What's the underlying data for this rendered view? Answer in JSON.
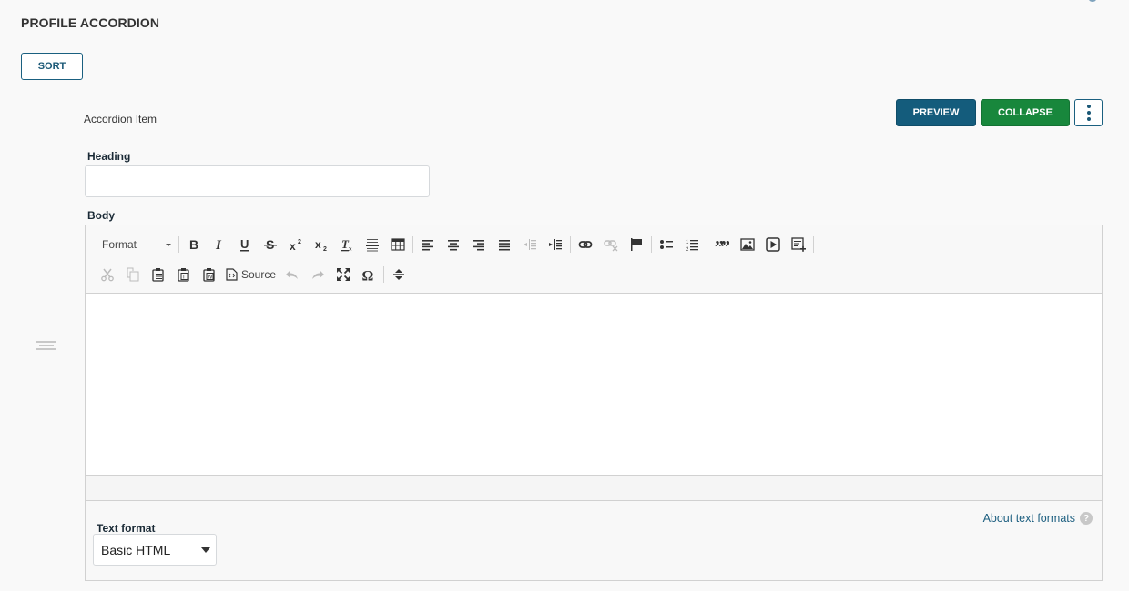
{
  "page": {
    "title": "PROFILE ACCORDION",
    "sort_label": "SORT"
  },
  "item": {
    "label": "Accordion Item",
    "preview_label": "PREVIEW",
    "collapse_label": "COLLAPSE",
    "more_icon": "vertical-ellipsis-icon"
  },
  "fields": {
    "heading": {
      "label": "Heading",
      "value": "",
      "placeholder": ""
    },
    "body": {
      "label": "Body",
      "value": ""
    }
  },
  "toolbar": {
    "format_label": "Format",
    "source_label": "Source",
    "row1": [
      "bold-icon",
      "italic-icon",
      "underline-icon",
      "strikethrough-icon",
      "superscript-icon",
      "subscript-icon",
      "remove-format-icon",
      "horizontal-line-icon",
      "table-icon",
      "align-left-icon",
      "align-center-icon",
      "align-right-icon",
      "justify-icon",
      "outdent-icon",
      "indent-icon",
      "link-icon",
      "unlink-icon",
      "anchor-icon",
      "bulleted-list-icon",
      "numbered-list-icon",
      "blockquote-icon",
      "image-icon",
      "media-icon",
      "template-icon"
    ],
    "row2": [
      "cut-icon",
      "copy-icon",
      "paste-icon",
      "paste-text-icon",
      "paste-word-icon",
      "source-icon",
      "undo-icon",
      "redo-icon",
      "maximize-icon",
      "special-char-icon",
      "show-blocks-icon"
    ]
  },
  "text_format": {
    "label": "Text format",
    "selected": "Basic HTML",
    "about_link": "About text formats",
    "help_icon": "?"
  },
  "colors": {
    "primary": "#145c7c",
    "success": "#18873c",
    "link": "#1d5f80"
  }
}
